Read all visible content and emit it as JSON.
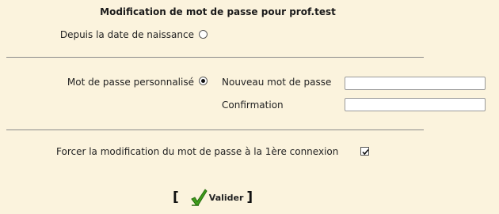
{
  "form": {
    "title": "Modification de mot de passe pour prof.test",
    "birthdate_option_label": "Depuis la date de naissance",
    "custom_option_label": "Mot de passe personnalisé",
    "new_password_label": "Nouveau mot de passe",
    "new_password_value": "",
    "confirmation_label": "Confirmation",
    "confirmation_value": "",
    "force_change_label": "Forcer la modification du mot de passe à la 1ère connexion",
    "force_change_checked": true,
    "selected_option": "custom"
  },
  "actions": {
    "bracket_open": "[",
    "validate_label": "Valider",
    "bracket_close": "]"
  },
  "icons": {
    "validate_icon": "green-checkmark-icon",
    "checkbox_icon": "checkmark-icon"
  },
  "colors": {
    "background": "#fbf3dd",
    "divider": "#8a8a8a",
    "validate_check": "#3f9c1a"
  }
}
